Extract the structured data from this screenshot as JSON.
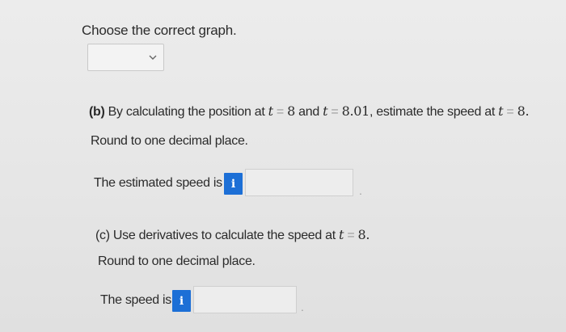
{
  "prompt": "Choose the correct graph.",
  "graph_select": {
    "value": "",
    "icon": "chevron-down-icon"
  },
  "part_b": {
    "label": "(b)",
    "text_1": " By calculating the position at ",
    "var_t": "t",
    "eq": " = ",
    "val_1": "8",
    "and": " and ",
    "val_2": "8.01",
    "text_2": ", estimate the speed at ",
    "val_3": "8.",
    "round": "Round to one decimal place.",
    "answer_label": "The estimated speed is",
    "info_glyph": "i",
    "answer_value": "",
    "trail": "."
  },
  "part_c": {
    "label": "(c)",
    "text_1": " Use derivatives to calculate the speed at ",
    "var_t": "t",
    "eq": " = ",
    "val_1": "8.",
    "round": "Round to one decimal place.",
    "answer_label": "The speed is",
    "info_glyph": "i",
    "answer_value": "",
    "trail": "."
  },
  "colors": {
    "info_button": "#1c6fd6",
    "background": "#e9e9e9"
  }
}
